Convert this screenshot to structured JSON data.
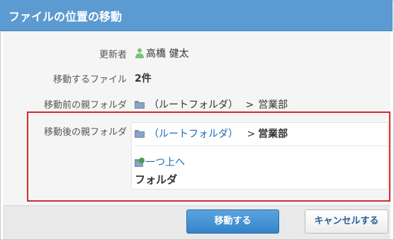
{
  "dialog": {
    "title": "ファイルの位置の移動"
  },
  "fields": {
    "updater": {
      "label": "更新者",
      "value": "高橋 健太"
    },
    "files": {
      "label": "移動するファイル",
      "value": "2件"
    },
    "source": {
      "label": "移動前の親フォルダ",
      "root": "（ルートフォルダ）",
      "separator": ">",
      "folder": "営業部"
    },
    "destination": {
      "label": "移動後の親フォルダ",
      "root_link": "（ルートフォルダ）",
      "separator": ">",
      "folder": "営業部",
      "up_link": "一つ上へ",
      "list_heading": "フォルダ"
    }
  },
  "buttons": {
    "move": "移動する",
    "cancel": "キャンセルする"
  },
  "colors": {
    "header": "#5b9bd1",
    "link": "#1a6bb8",
    "highlight_border": "#d32b2b",
    "primary_button": "#3584c8"
  }
}
